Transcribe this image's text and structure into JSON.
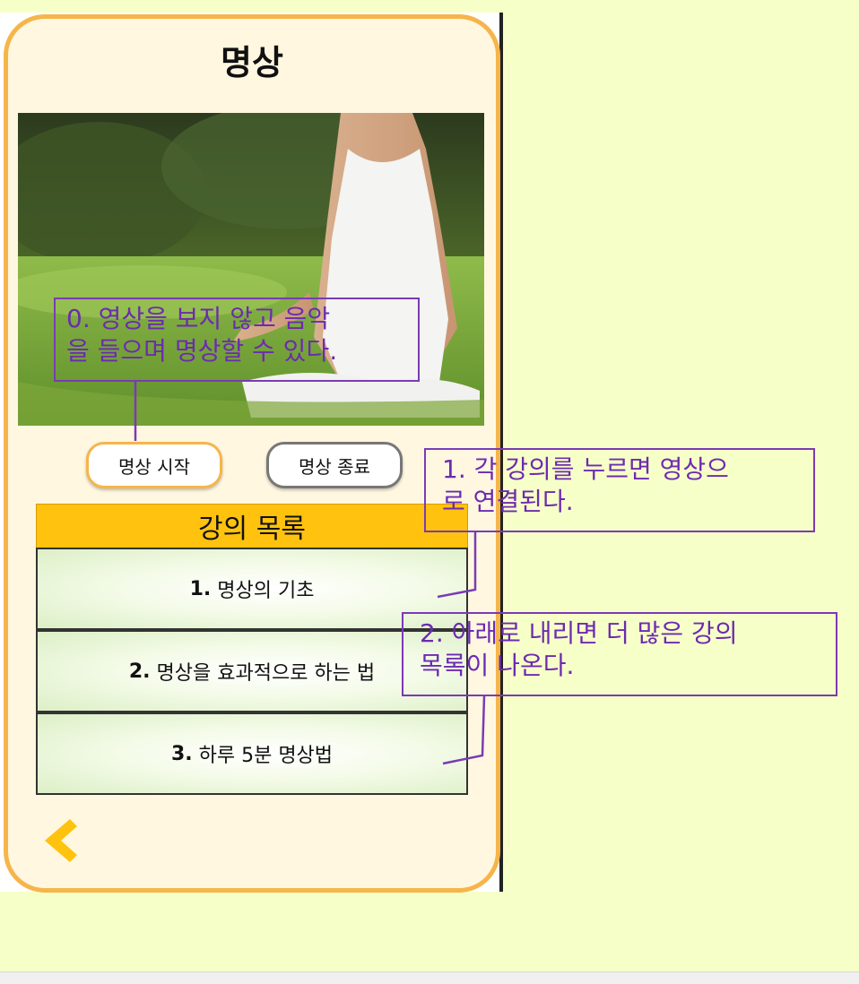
{
  "app": {
    "title": "명상"
  },
  "controls": {
    "start_label": "명상 시작",
    "end_label": "명상 종료"
  },
  "lecture_list": {
    "header": "강의 목록",
    "items": [
      {
        "number": "1.",
        "title": "명상의 기초"
      },
      {
        "number": "2.",
        "title": "명상을 효과적으로 하는 법"
      },
      {
        "number": "3.",
        "title": "하루 5분 명상법"
      }
    ]
  },
  "annotations": [
    {
      "text": "0. 영상을 보지 않고 음악\n을 들으며 명상할 수 있다."
    },
    {
      "text": "1. 각 강의를 누르면 영상으\n로 연결된다."
    },
    {
      "text": "2. 아래로 내리면 더 많은 강의\n목록이 나온다."
    }
  ],
  "icons": {
    "back": "chevron-left-icon"
  },
  "colors": {
    "background": "#f7ffc8",
    "frame_border": "#f6b54a",
    "frame_fill": "#fff7e0",
    "list_header": "#ffc20e",
    "annotation": "#6c2bb0",
    "back_chevron": "#ffc20e"
  }
}
